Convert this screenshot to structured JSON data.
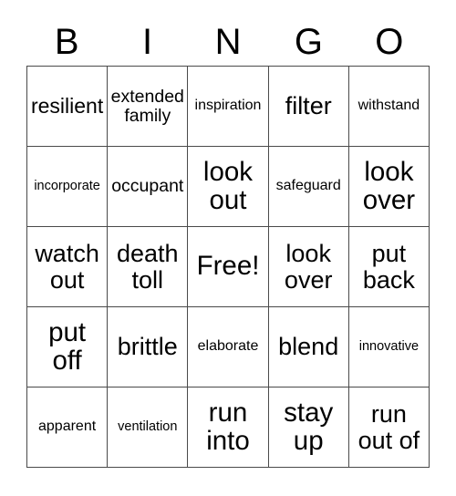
{
  "card": {
    "header": {
      "letters": [
        "B",
        "I",
        "N",
        "G",
        "O"
      ]
    },
    "free_space_label": "Free!",
    "cells": [
      {
        "text": "resilient",
        "size": "fs-l"
      },
      {
        "text": "extended\nfamily",
        "size": "fs-m"
      },
      {
        "text": "inspiration",
        "size": "fs-s"
      },
      {
        "text": "filter",
        "size": "fs-xl"
      },
      {
        "text": "withstand",
        "size": "fs-s"
      },
      {
        "text": "incorporate",
        "size": "fs-xs"
      },
      {
        "text": "occupant",
        "size": "fs-m"
      },
      {
        "text": "look\nout",
        "size": "fs-xxl"
      },
      {
        "text": "safeguard",
        "size": "fs-s"
      },
      {
        "text": "look\nover",
        "size": "fs-xxl"
      },
      {
        "text": "watch\nout",
        "size": "fs-xl"
      },
      {
        "text": "death\ntoll",
        "size": "fs-xl"
      },
      {
        "text": "Free!",
        "size": "fs-xxl"
      },
      {
        "text": "look\nover",
        "size": "fs-xl"
      },
      {
        "text": "put\nback",
        "size": "fs-xl"
      },
      {
        "text": "put\noff",
        "size": "fs-xxl"
      },
      {
        "text": "brittle",
        "size": "fs-xl"
      },
      {
        "text": "elaborate",
        "size": "fs-s"
      },
      {
        "text": "blend",
        "size": "fs-xl"
      },
      {
        "text": "innovative",
        "size": "fs-xs"
      },
      {
        "text": "apparent",
        "size": "fs-s"
      },
      {
        "text": "ventilation",
        "size": "fs-xs"
      },
      {
        "text": "run\ninto",
        "size": "fs-xxl"
      },
      {
        "text": "stay\nup",
        "size": "fs-xxl"
      },
      {
        "text": "run\nout of",
        "size": "fs-xl"
      }
    ]
  },
  "colors": {
    "background": "#ffffff",
    "text": "#000000",
    "border": "#4a4a4a"
  }
}
